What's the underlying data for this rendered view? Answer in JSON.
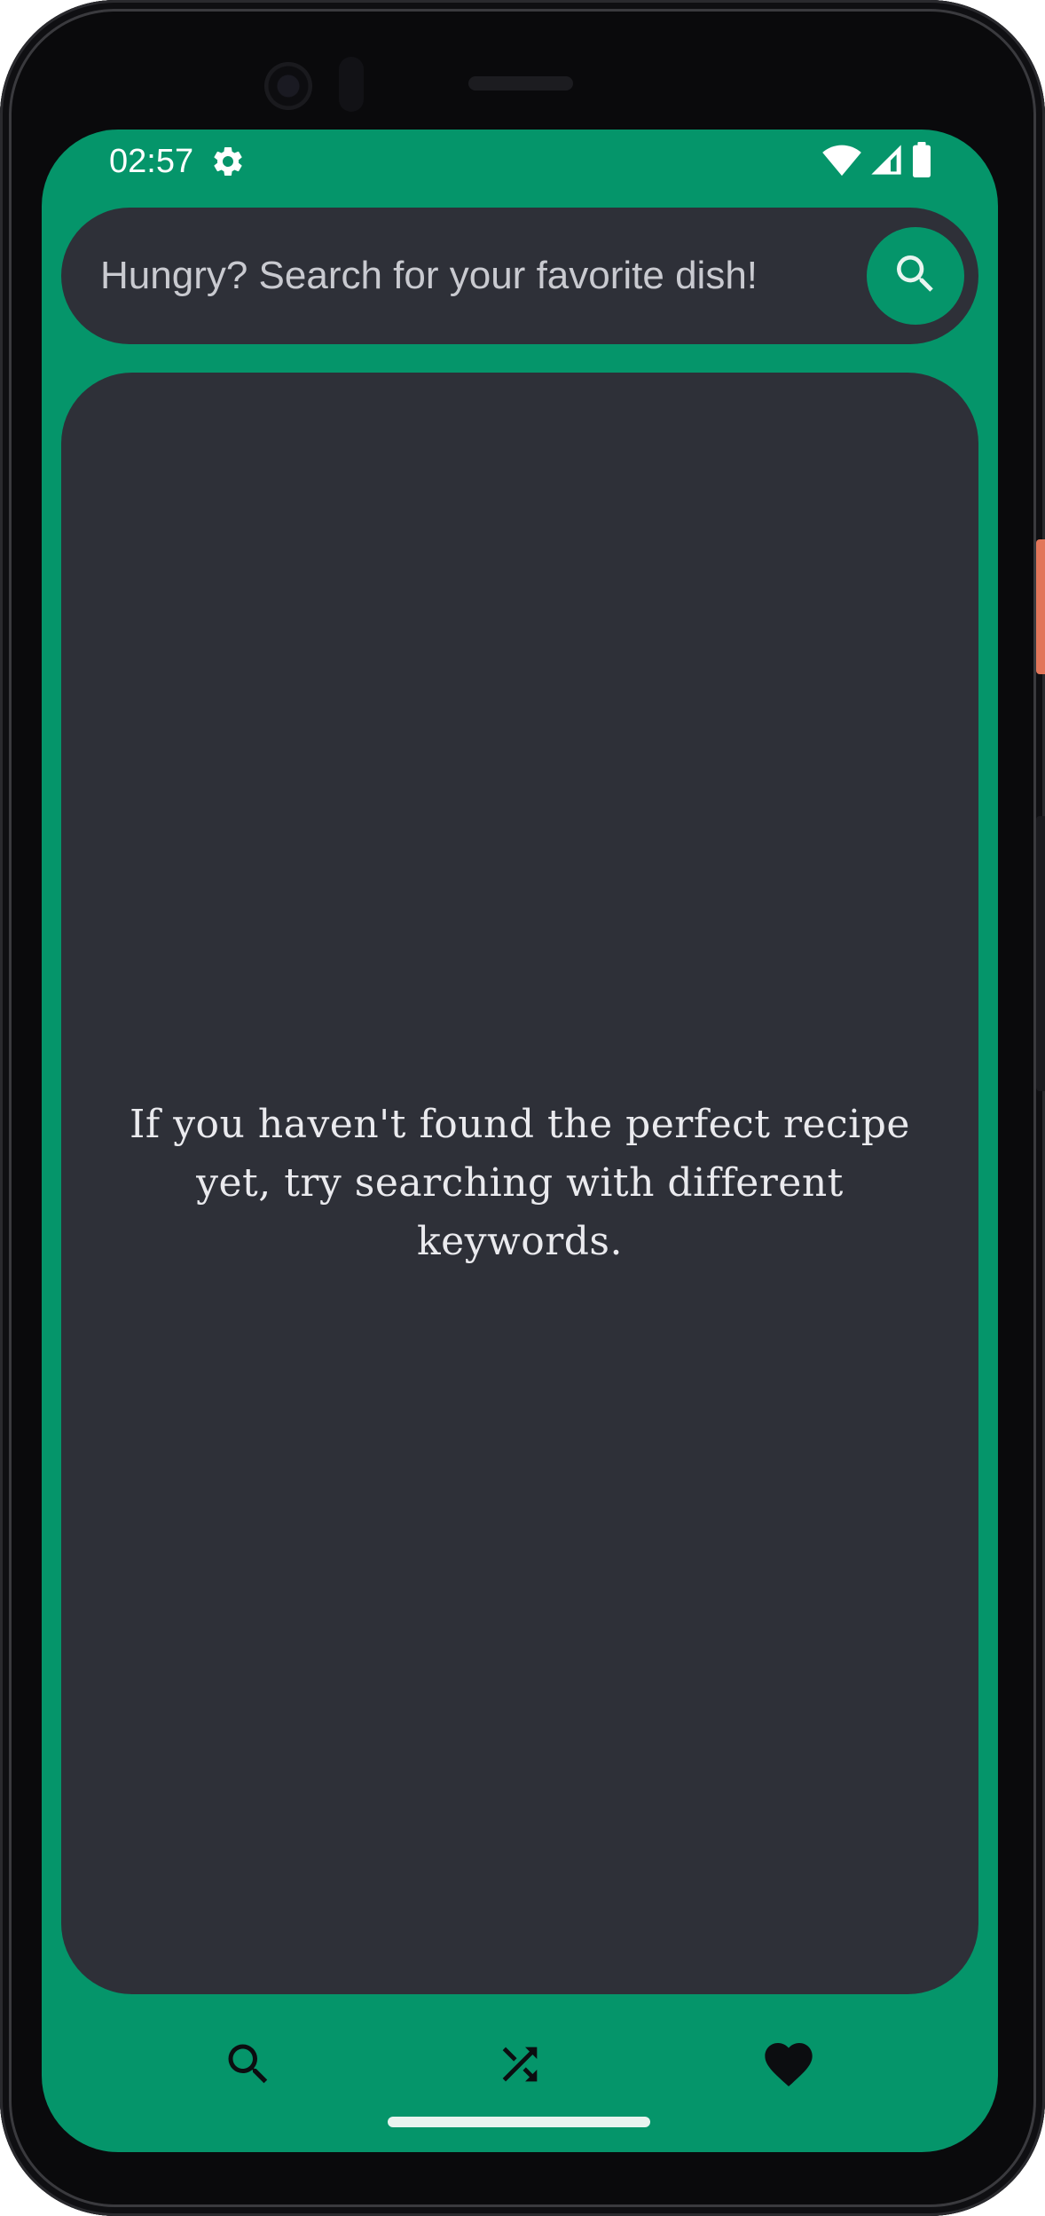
{
  "status_bar": {
    "time": "02:57",
    "settings_icon": "gear-icon",
    "wifi_icon": "wifi-icon",
    "signal_icon": "cell-signal-icon",
    "battery_icon": "battery-icon"
  },
  "search": {
    "placeholder": "Hungry? Search for your favorite dish!",
    "value": "",
    "button_icon": "search-icon"
  },
  "content": {
    "empty_message": "If you haven't found the perfect recipe yet, try searching with different keywords."
  },
  "bottom_nav": {
    "items": [
      {
        "icon": "search-icon"
      },
      {
        "icon": "shuffle-icon"
      },
      {
        "icon": "heart-icon"
      }
    ]
  },
  "colors": {
    "primary": "#05956a",
    "surface": "#2e3038",
    "on_primary_icon": "#0c0d10",
    "text": "#eaeaee"
  }
}
